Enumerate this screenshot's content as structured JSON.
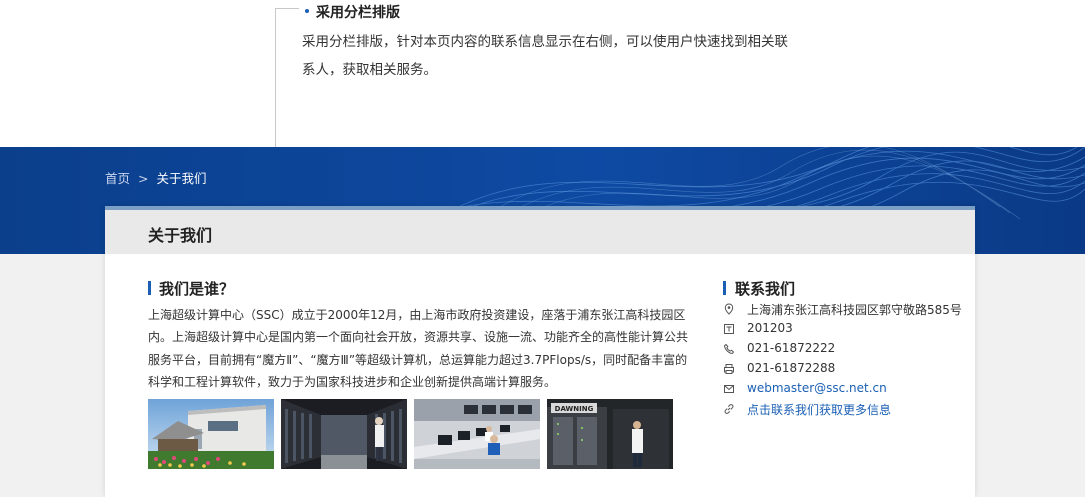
{
  "annotation": {
    "title": "采用分栏排版",
    "text": "采用分栏排版，针对本页内容的联系信息显示在右侧，可以使用户快速找到相关联系人，获取相关服务。"
  },
  "breadcrumb": {
    "home": "首页",
    "separator": ">",
    "current": "关于我们"
  },
  "page_title": "关于我们",
  "about": {
    "heading": "我们是谁？",
    "paragraph": "上海超级计算中心（SSC）成立于2000年12月，由上海市政府投资建设，座落于浦东张江高科技园区内。上海超级计算中心是国内第一个面向社会开放，资源共享、设施一流、功能齐全的高性能计算公共服务平台，目前拥有“魔方Ⅱ”、“魔方Ⅲ”等超级计算机，总运算能力超过3.7PFlops/s，同时配备丰富的科学和工程计算软件，致力于为国家科技进步和企业创新提供高端计算服务。",
    "photos": [
      {
        "icon": "building-photo-icon"
      },
      {
        "icon": "server-room-photo-icon"
      },
      {
        "icon": "control-room-photo-icon"
      },
      {
        "icon": "dawning-rack-photo-icon",
        "label": "DAWNING"
      }
    ]
  },
  "contact": {
    "heading": "联系我们",
    "items": [
      {
        "icon": "location-icon",
        "text": "上海浦东张江高科技园区郭守敬路585号"
      },
      {
        "icon": "postcode-icon",
        "text": "201203"
      },
      {
        "icon": "phone-icon",
        "text": "021-61872222"
      },
      {
        "icon": "fax-icon",
        "text": "021-61872288"
      },
      {
        "icon": "mail-icon",
        "text": "webmaster@ssc.net.cn",
        "link": true
      },
      {
        "icon": "link-icon",
        "text": "点击联系我们获取更多信息",
        "link": true
      }
    ]
  },
  "colors": {
    "hero_blue": "#0e4aa3",
    "accent": "#1a5fb4",
    "card_header": "#e9e9e9"
  }
}
